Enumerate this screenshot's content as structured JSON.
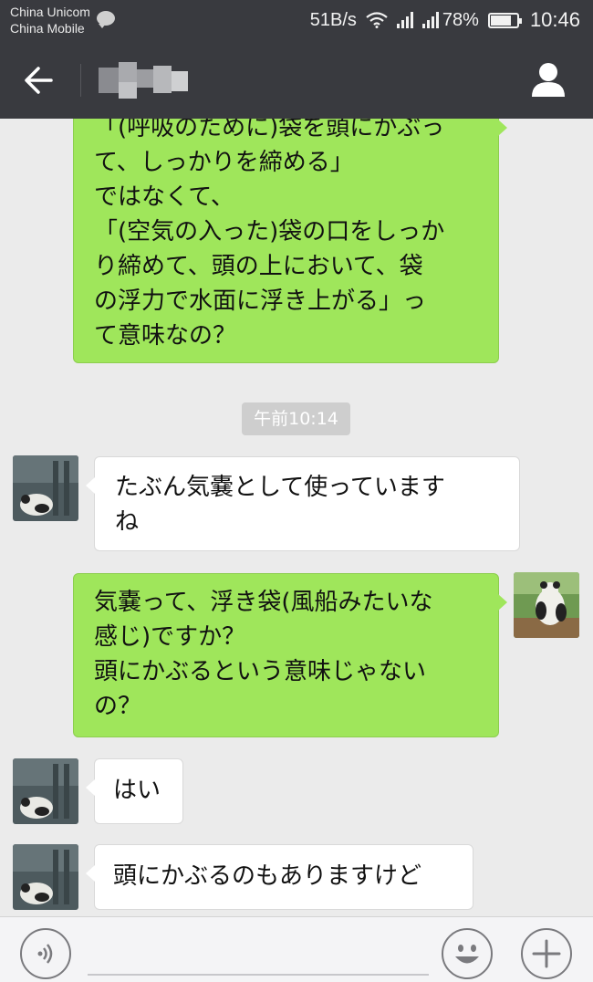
{
  "status_bar": {
    "carrier_1": "China Unicom",
    "carrier_2": "China Mobile",
    "notification_icon": "chat-bubble-icon",
    "network_speed": "51B/s",
    "battery_percent": "78%",
    "battery_level": 0.78,
    "time": "10:46"
  },
  "header": {
    "back_icon": "arrow-left-icon",
    "contact_name_blurred": true,
    "profile_icon": "person-icon"
  },
  "messages": [
    {
      "side": "out",
      "lines": [
        "「(呼吸のために)袋を頭にかぶっ",
        "て、しっかりを締める」",
        "ではなくて、",
        "「(空気の入った)袋の口をしっか",
        "り締めて、頭の上において、袋",
        "の浮力で水面に浮き上がる」っ",
        "て意味なの？"
      ]
    },
    {
      "type": "timestamp",
      "text": "午前10:14"
    },
    {
      "side": "in",
      "lines": [
        "たぶん気嚢として使っています",
        "ね"
      ]
    },
    {
      "side": "out",
      "lines": [
        "気嚢って、浮き袋(風船みたいな",
        "感じ)ですか？",
        "頭にかぶるという意味じゃない",
        "の？"
      ]
    },
    {
      "side": "in",
      "lines": [
        "はい"
      ]
    },
    {
      "side": "in",
      "lines": [
        "頭にかぶるのもありますけど"
      ]
    }
  ],
  "input_bar": {
    "voice_icon": "voice-icon",
    "emoji_icon": "smiley-icon",
    "plus_icon": "plus-icon"
  },
  "colors": {
    "bar": "#393a3f",
    "chat_bg": "#ebebeb",
    "outgoing_bubble": "#9fe65b",
    "incoming_bubble": "#ffffff",
    "timestamp_bg": "#cecece"
  }
}
